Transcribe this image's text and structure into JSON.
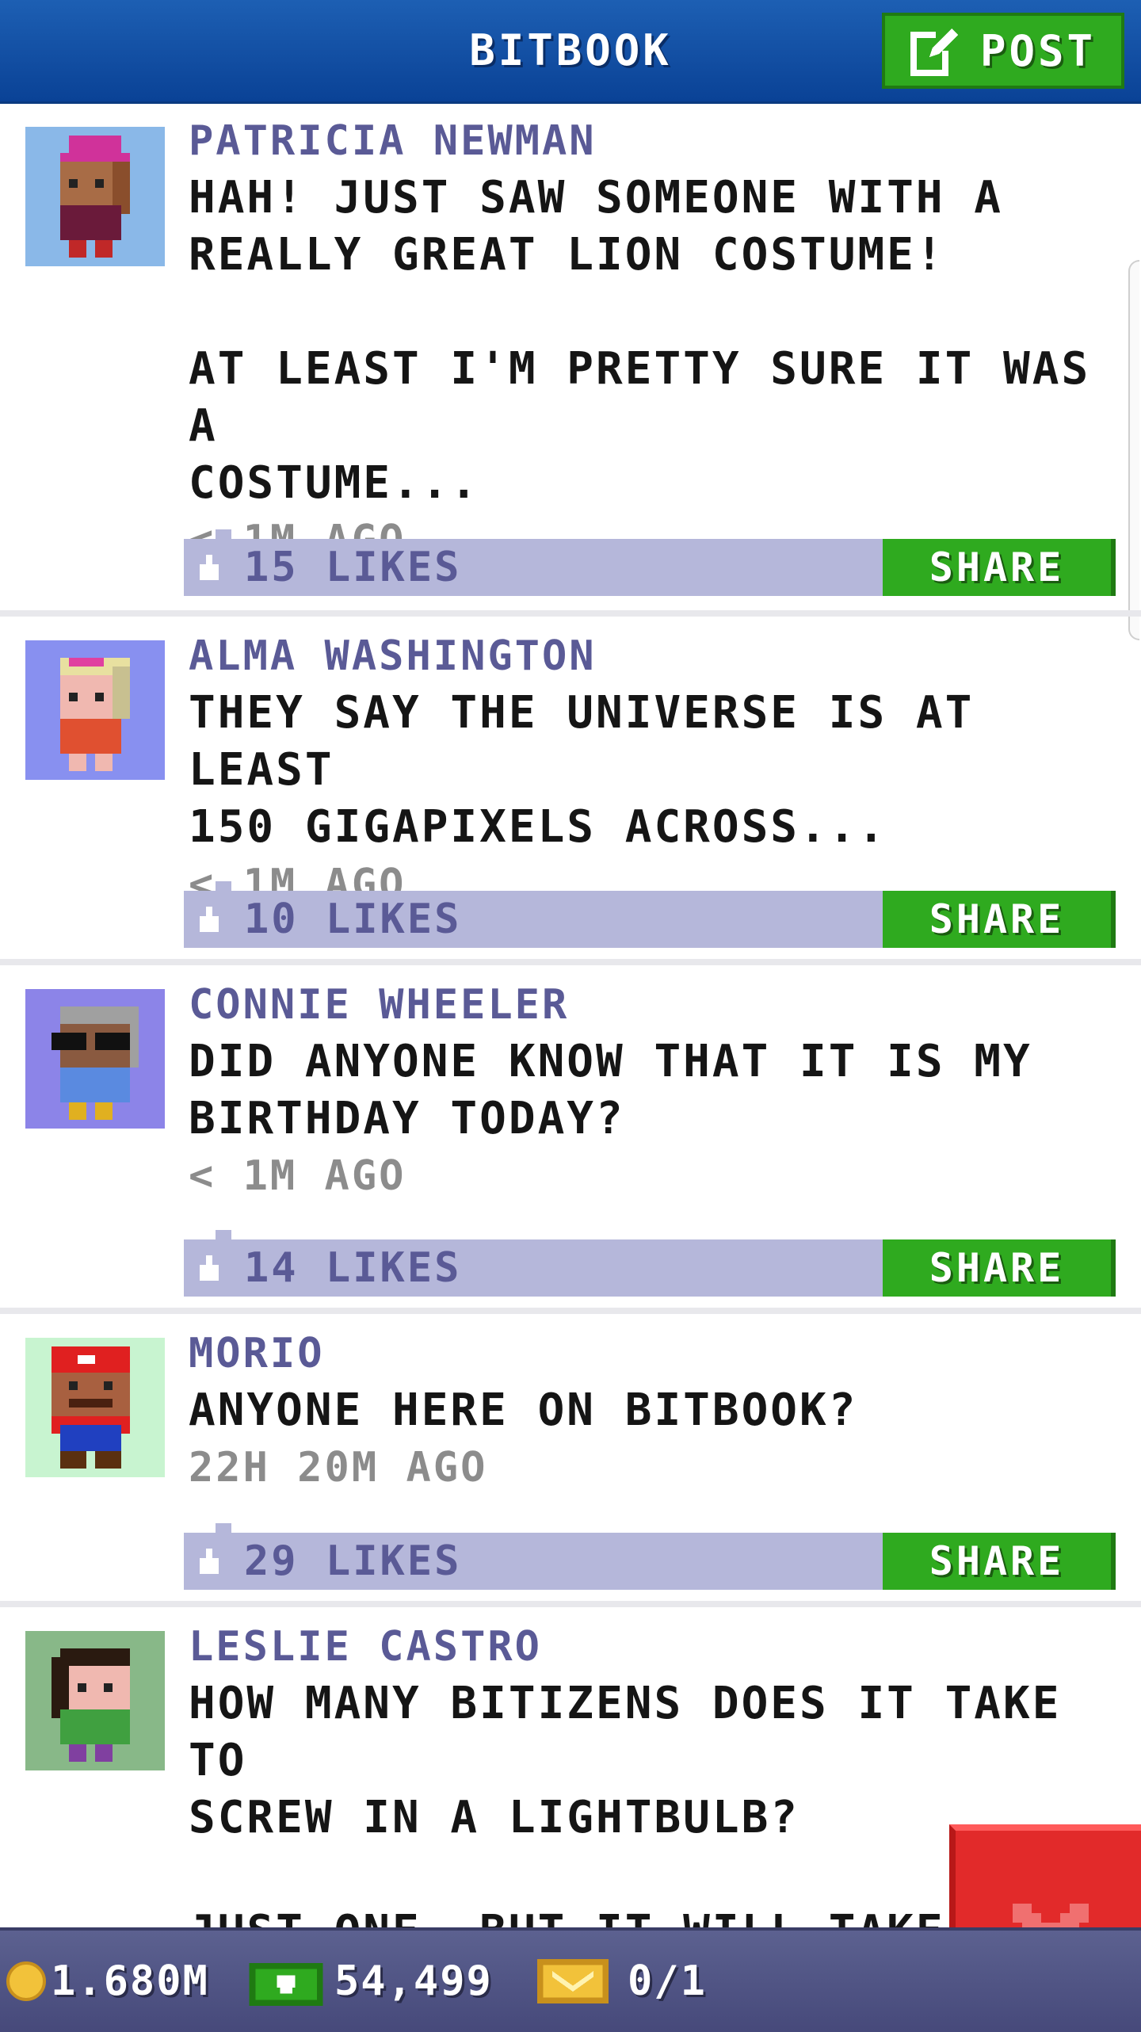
{
  "header": {
    "title": "BITBOOK",
    "post_label": "POST"
  },
  "feed": [
    {
      "author": "PATRICIA NEWMAN",
      "message": "HAH! JUST SAW SOMEONE WITH A\nREALLY GREAT LION COSTUME!\n\nAT LEAST I'M PRETTY SURE IT WAS A\nCOSTUME...",
      "time": "< 1M AGO",
      "likes": "15 LIKES",
      "share_label": "SHARE",
      "avatar_bg": "#8ab8e8"
    },
    {
      "author": "ALMA WASHINGTON",
      "message": "THEY SAY THE UNIVERSE IS AT LEAST\n150 GIGAPIXELS ACROSS...",
      "time": "< 1M AGO",
      "likes": "10 LIKES",
      "share_label": "SHARE",
      "avatar_bg": "#8890f0"
    },
    {
      "author": "CONNIE WHEELER",
      "message": "DID ANYONE KNOW THAT IT IS MY\nBIRTHDAY TODAY?",
      "time": "< 1M AGO",
      "likes": "14 LIKES",
      "share_label": "SHARE",
      "avatar_bg": "#8c84e8"
    },
    {
      "author": "MORIO",
      "message": "ANYONE HERE ON BITBOOK?",
      "time": "22H 20M AGO",
      "likes": "29 LIKES",
      "share_label": "SHARE",
      "avatar_bg": "#c8f4d0"
    },
    {
      "author": "LESLIE CASTRO",
      "message": "HOW MANY BITIZENS DOES IT TAKE TO\nSCREW IN A LIGHTBULB?\n\nJUST ONE, BUT IT WILL TAKE HIM",
      "time": "",
      "likes": "",
      "share_label": "",
      "avatar_bg": "#88b888"
    }
  ],
  "status": {
    "coins": "1.680M",
    "bux": "54,499",
    "tickets": "0/1"
  },
  "colors": {
    "header": "#0a4296",
    "accent_green": "#2faa1f",
    "like_bar": "#b5b7da",
    "author": "#5a5a96",
    "close_red": "#e22a2a"
  },
  "icons": [
    "compose-icon",
    "thumbs-up-icon",
    "coin-icon",
    "bux-icon",
    "ticket-icon",
    "close-icon"
  ]
}
